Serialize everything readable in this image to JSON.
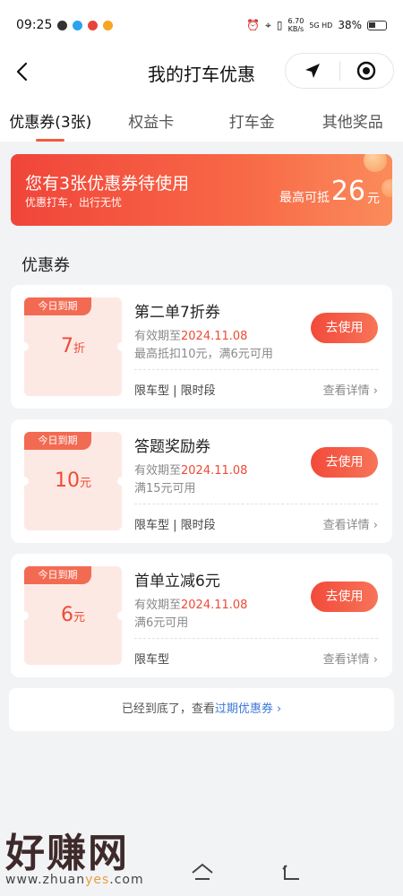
{
  "status": {
    "time": "09:25",
    "speed": "6.70\nKB/s",
    "network": "5G HD",
    "battery": "38%"
  },
  "nav": {
    "title": "我的打车优惠"
  },
  "tabs": [
    {
      "label": "优惠券(3张)"
    },
    {
      "label": "权益卡"
    },
    {
      "label": "打车金"
    },
    {
      "label": "其他奖品"
    }
  ],
  "banner": {
    "title": "您有3张优惠券待使用",
    "sub": "优惠打车，出行无忧",
    "max_label": "最高可抵",
    "max_value": "26",
    "max_unit": "元"
  },
  "section_title": "优惠券",
  "coupons": [
    {
      "tag": "今日到期",
      "amount": "7",
      "unit": "折",
      "title": "第二单7折券",
      "valid_prefix": "有效期至",
      "valid_date": "2024.11.08",
      "condition": "最高抵扣10元，满6元可用",
      "use_label": "去使用",
      "tags": "限车型 | 限时段",
      "detail": "查看详情 ›"
    },
    {
      "tag": "今日到期",
      "amount": "10",
      "unit": "元",
      "title": "答题奖励券",
      "valid_prefix": "有效期至",
      "valid_date": "2024.11.08",
      "condition": "满15元可用",
      "use_label": "去使用",
      "tags": "限车型 | 限时段",
      "detail": "查看详情 ›"
    },
    {
      "tag": "今日到期",
      "amount": "6",
      "unit": "元",
      "title": "首单立减6元",
      "valid_prefix": "有效期至",
      "valid_date": "2024.11.08",
      "condition": "满6元可用",
      "use_label": "去使用",
      "tags": "限车型",
      "detail": "查看详情 ›"
    }
  ],
  "bottom": {
    "text": "已经到底了，查看",
    "link": "过期优惠券 ›"
  },
  "watermark": {
    "big": "好赚网",
    "small_a": "www.zhuan",
    "small_b": "yes",
    "small_c": ".com"
  }
}
